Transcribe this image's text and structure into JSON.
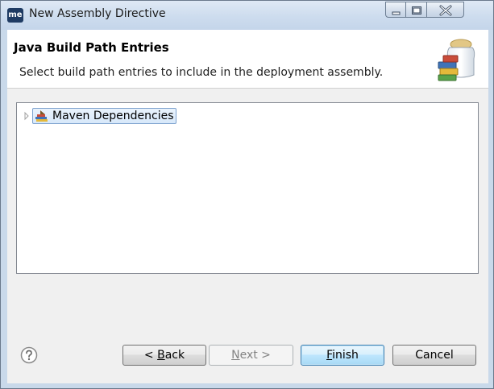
{
  "window": {
    "title": "New Assembly Directive",
    "app_icon_text": "me",
    "caption_buttons": [
      "minimize-icon",
      "maximize-icon",
      "close-icon"
    ]
  },
  "header": {
    "title": "Java Build Path Entries",
    "description": "Select build path entries to include in the deployment assembly.",
    "icon": "library-jar-icon"
  },
  "tree": {
    "items": [
      {
        "label": "Maven Dependencies",
        "icon": "maven-library-icon",
        "expanded": false,
        "selected": true
      }
    ]
  },
  "buttons": {
    "back": {
      "mnemonic": "B",
      "prefix": "< ",
      "rest": "ack"
    },
    "next": {
      "mnemonic": "N",
      "rest": "ext >"
    },
    "finish": {
      "mnemonic": "F",
      "rest": "inish"
    },
    "cancel": {
      "label": "Cancel"
    }
  },
  "colors": {
    "title_bar": "#cddcee",
    "selection_border": "#7da2ce",
    "default_button_border": "#3c7fb1"
  }
}
